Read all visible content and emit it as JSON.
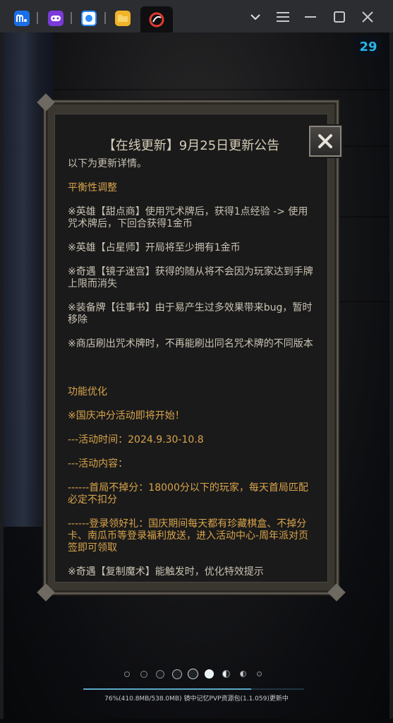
{
  "tabs": [
    {
      "name": "app-m-icon",
      "color": "#1a6fe8"
    },
    {
      "name": "gamepad-icon",
      "color": "#7a3bd8"
    },
    {
      "name": "box-icon",
      "color": "#2a8cff"
    },
    {
      "name": "folder-icon",
      "color": "#f0b429"
    },
    {
      "name": "game-logo-icon",
      "color": "#c0392b"
    }
  ],
  "timer": "29",
  "dialog": {
    "title": "【在线更新】9月25日更新公告",
    "intro": "以下为更新详情。",
    "balance_heading": "平衡性调整",
    "items": [
      "※英雄【甜点商】使用咒术牌后，获得1点经验 -> 使用咒术牌后，下回合获得1金币",
      "※英雄【占星师】开局将至少拥有1金币",
      "※奇遇【镜子迷宫】获得的随从将不会因为玩家达到手牌上限而消失",
      "※装备牌【往事书】由于易产生过多效果带来bug，暂时移除",
      "※商店刷出咒术牌时，不再能刷出同名咒术牌的不同版本"
    ],
    "feature_heading": "功能优化",
    "event_title": "※国庆冲分活动即将开始！",
    "event_time": "---活动时间：2024.9.30-10.8",
    "event_content_label": "---活动内容：",
    "event_item1": "------首局不掉分：18000分以下的玩家，每天首局匹配必定不扣分",
    "event_item2": "------登录领好礼：国庆期间每天都有珍藏棋盒、不掉分卡、南瓜币等登录福利放送，进入活动中心-周年派对页签即可领取",
    "cut_line": "※奇遇【复制魔术】能触发时，优化特效提示"
  },
  "progress": {
    "fraction": 0.76,
    "text": "76%(410.8MB/538.0MB)   镜中记忆PVP资源包(1.1.059)更新中"
  },
  "colors": {
    "accent_gold": "#d9a44a",
    "timer_blue": "#26b7e8"
  }
}
